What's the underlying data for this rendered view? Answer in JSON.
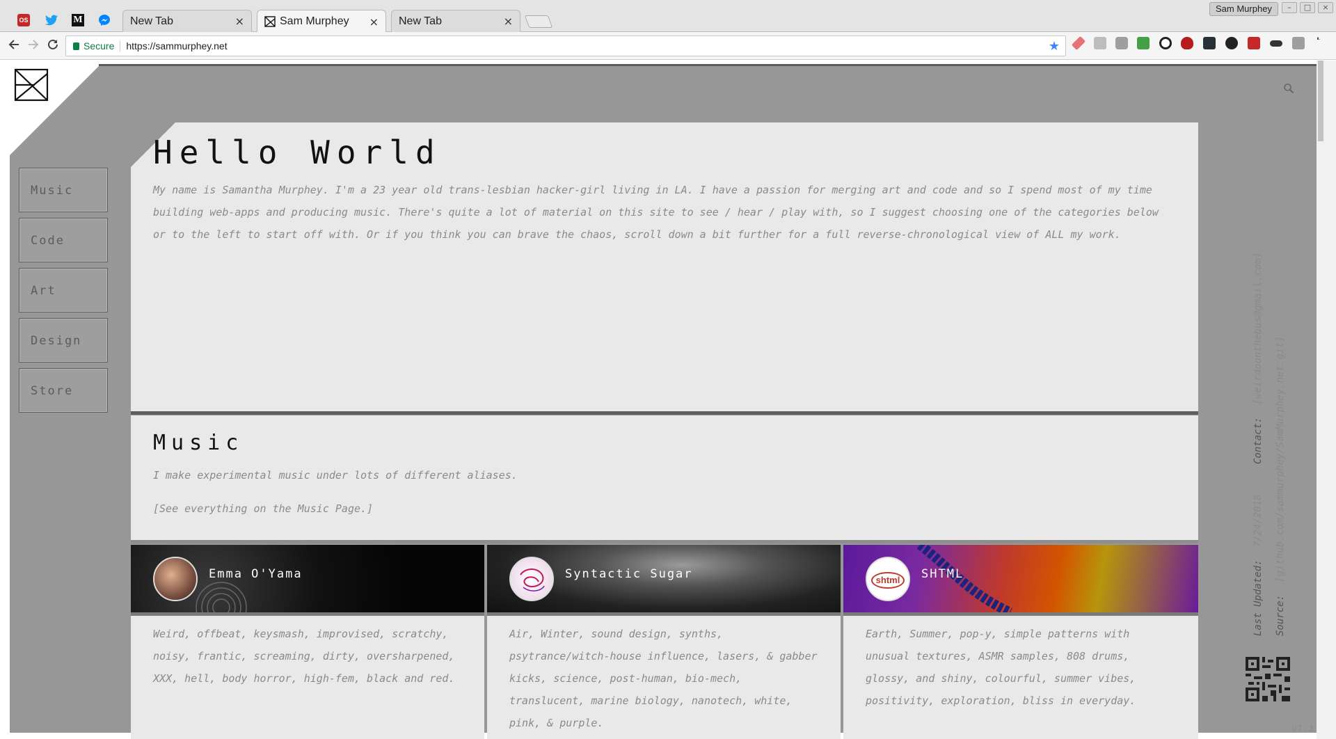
{
  "browser": {
    "tabs": [
      {
        "title": "New Tab"
      },
      {
        "title": "Sam Murphey"
      },
      {
        "title": "New Tab"
      }
    ],
    "close_glyph": "×",
    "profile_name": "Sam Murphey",
    "secure_label": "Secure",
    "url": "https://sammurphey.net",
    "pinned_labels": {
      "os": "OS",
      "medium": "M"
    },
    "win_glyphs": {
      "minimize": "–",
      "maximize": "□",
      "close": "×"
    }
  },
  "site": {
    "nav": [
      {
        "label": "Music"
      },
      {
        "label": "Code"
      },
      {
        "label": "Art"
      },
      {
        "label": "Design"
      },
      {
        "label": "Store"
      }
    ],
    "hero": {
      "title": "Hello World",
      "body": "My name is Samantha Murphey. I'm a 23 year old trans-lesbian hacker-girl living in LA. I have a passion for merging art and code and so I spend most of my time building web-apps and producing music. There's quite a lot of material on this site to see / hear / play with, so I suggest choosing one of the categories below or to the left to start off with. Or if you think you can brave the chaos, scroll down a bit further for a full reverse-chronological view of ALL my work."
    },
    "music": {
      "title": "Music",
      "intro": "I make experimental music under lots of different aliases.",
      "link": "[See everything on the Music Page.]"
    },
    "aliases": [
      {
        "name": "Emma O'Yama",
        "desc": "Weird, offbeat, keysmash, improvised, scratchy, noisy, frantic, screaming, dirty, oversharpened, XXX, hell, body horror, high-fem, black and red."
      },
      {
        "name": "Syntactic Sugar",
        "desc": "Air, Winter, sound design, synths, psytrance/witch-house influence, lasers, & gabber kicks, science, post-human, bio-mech, translucent, marine biology, nanotech, white, pink, & purple."
      },
      {
        "name": "SHTML",
        "desc": "Earth, Summer, pop-y, simple patterns with unusual textures, ASMR samples, 808 drums, glossy, and shiny, colourful, summer vibes, positivity, exploration, bliss in everyday.",
        "badge": "shtml"
      }
    ],
    "footer": {
      "contact_label": "Contact:",
      "contact_value": "[weirdoonthebus@gmail.com]",
      "updated_label": "Last Updated:",
      "updated_value": "7/24/2018",
      "source_label": "Source:",
      "source_value": "[github.com/sammurphey/SamMurphey.net.git]",
      "version": "v7.3"
    }
  },
  "colors": {
    "frame": "#979797",
    "panel": "#e9e9e9",
    "muted_text": "#8a8a8a",
    "secure_green": "#0b8043",
    "bookmark_blue": "#4285f4"
  },
  "icons": [
    "back-icon",
    "forward-icon",
    "reload-icon",
    "lock-icon",
    "star-icon",
    "search-icon",
    "site-logo-icon",
    "qr-code-icon"
  ]
}
